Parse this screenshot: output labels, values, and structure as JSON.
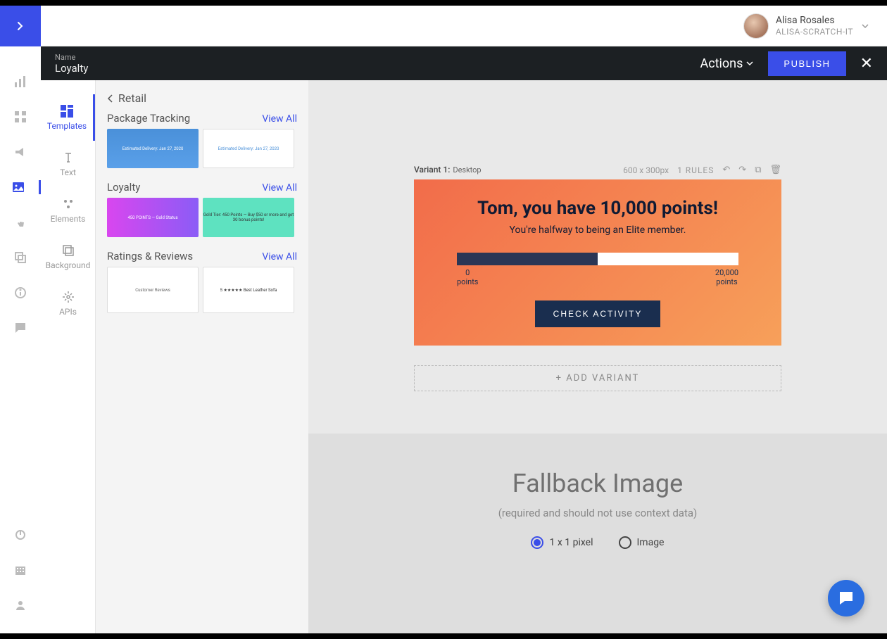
{
  "user": {
    "name": "Alisa Rosales",
    "org": "ALISA-SCRATCH-IT"
  },
  "namebar": {
    "label": "Name",
    "value": "Loyalty",
    "actions": "Actions",
    "publish": "PUBLISH"
  },
  "tools": {
    "templates": "Templates",
    "text": "Text",
    "elements": "Elements",
    "background": "Background",
    "apis": "APIs"
  },
  "browser": {
    "back": "Retail",
    "viewall": "View All",
    "categories": {
      "package_tracking": "Package Tracking",
      "loyalty": "Loyalty",
      "ratings": "Ratings & Reviews"
    },
    "thumbs": {
      "pt1": "Estimated Delivery: Jan 27, 2020",
      "pt2": "Estimated Delivery: Jan 27, 2020",
      "loy1": "450 POINTS — Gold Status",
      "loy2": "Gold Tier: 450 Points — Buy $50 or more and get 30 bonus points!",
      "rr1": "Customer Reviews",
      "rr2": "5 ★★★★★ Best Leather Sofa"
    }
  },
  "variant": {
    "label": "Variant 1:",
    "device": "Desktop",
    "dims": "600 x 300px",
    "rules": "1 RULES"
  },
  "preview": {
    "title": "Tom, you have 10,000 points!",
    "subtitle": "You're halfway to being an Elite member.",
    "min_val": "0",
    "min_lbl": "points",
    "max_val": "20,000",
    "max_lbl": "points",
    "cta": "CHECK ACTIVITY"
  },
  "add_variant": "+ ADD VARIANT",
  "fallback": {
    "title": "Fallback Image",
    "subtitle": "(required and should not use context data)",
    "opt1": "1 x 1 pixel",
    "opt2": "Image"
  }
}
